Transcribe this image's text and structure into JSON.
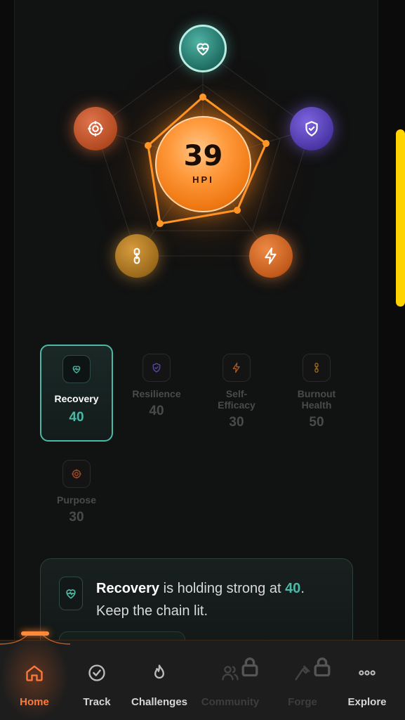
{
  "hpi": {
    "value": "39",
    "label": "HPI"
  },
  "radar_orbs": [
    {
      "icon": "heart-pulse-icon",
      "color": "#4fb3a3"
    },
    {
      "icon": "shield-check-icon",
      "color": "#7d66e0"
    },
    {
      "icon": "lightning-bolt-icon",
      "color": "#ee8a46"
    },
    {
      "icon": "chain-link-icon",
      "color": "#d89c3e"
    },
    {
      "icon": "target-icon",
      "color": "#e0744c"
    }
  ],
  "metrics": [
    {
      "name": "Recovery",
      "value": "40",
      "icon": "heart-pulse-icon",
      "selected": true
    },
    {
      "name": "Resilience",
      "value": "40",
      "icon": "shield-check-icon"
    },
    {
      "name": "Self-\nEfficacy",
      "value": "30",
      "icon": "lightning-bolt-icon"
    },
    {
      "name": "Burnout\nHealth",
      "value": "50",
      "icon": "chain-link-icon"
    },
    {
      "name": "Purpose",
      "value": "30",
      "icon": "target-icon"
    }
  ],
  "info_card": {
    "metric_name": "Recovery",
    "middle_text": " is holding strong at ",
    "metric_value": "40",
    "end_text": ".",
    "line2": "Keep the chain lit."
  },
  "nav": {
    "items": [
      {
        "label": "Home",
        "icon": "home-icon",
        "state": "active"
      },
      {
        "label": "Track",
        "icon": "check-circle-icon",
        "state": "normal"
      },
      {
        "label": "Challenges",
        "icon": "flame-icon",
        "state": "normal"
      },
      {
        "label": "Community",
        "icon": "users-icon",
        "state": "locked"
      },
      {
        "label": "Forge",
        "icon": "hammer-icon",
        "state": "locked"
      },
      {
        "label": "Explore",
        "icon": "more-dots-icon",
        "state": "normal"
      }
    ]
  },
  "colors": {
    "accent_teal": "#4cb9a6",
    "accent_orange": "#ff7a3a",
    "scrollbar": "#ffd400"
  }
}
